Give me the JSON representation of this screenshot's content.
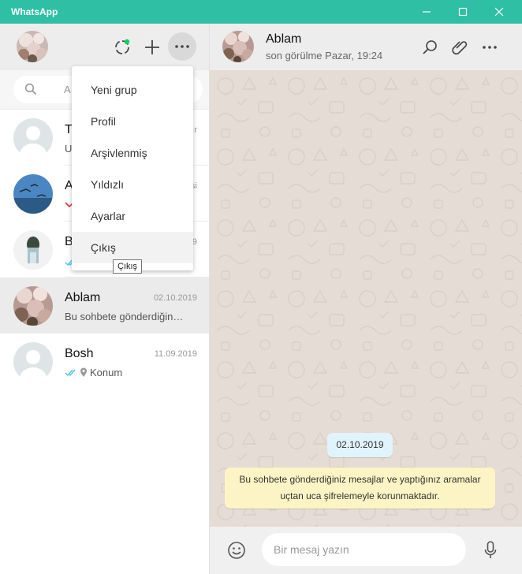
{
  "window": {
    "title": "WhatsApp"
  },
  "left_header": {
    "icons": [
      "status-icon",
      "new-chat-icon",
      "menu-dots-icon"
    ],
    "status_accent": "#09d261"
  },
  "search": {
    "placeholder_visible": "A"
  },
  "menu": {
    "items": [
      "Yeni grup",
      "Profil",
      "Arşivlenmiş",
      "Yıldızlı",
      "Ayarlar",
      "Çıkış"
    ],
    "hovered": "Çıkış",
    "tooltip": "Çıkış"
  },
  "chats": [
    {
      "name": "T",
      "date": "r",
      "preview": "U",
      "preview_icon": ""
    },
    {
      "name": "A",
      "date": "si",
      "preview": "",
      "preview_icon": "missed-call-icon"
    },
    {
      "name": "B",
      "date": "9",
      "preview": "",
      "preview_icon": "double-check-icon"
    },
    {
      "name": "Ablam",
      "date": "02.10.2019",
      "preview": "Bu sohbete gönderdiğin…",
      "preview_icon": ""
    },
    {
      "name": "Bosh",
      "date": "11.09.2019",
      "preview": "Konum",
      "preview_icon": "location-pin-icon"
    }
  ],
  "conversation": {
    "name": "Ablam",
    "status": "son görülme Pazar, 19:24",
    "date_chip": "02.10.2019",
    "encryption_line1": "Bu sohbete gönderdiğiniz mesajlar ve yaptığınız aramalar",
    "encryption_line2": "uçtan uca şifrelemeyle korunmaktadır.",
    "input_placeholder": "Bir mesaj yazın"
  },
  "colors": {
    "titlebar": "#2ebfa5",
    "wallpaper": "#e5ddd5",
    "date_chip": "#e1f3fb",
    "encryption_note": "#fcf4c4",
    "read_tick": "#4fc3f7",
    "missed_call": "#df3333"
  }
}
